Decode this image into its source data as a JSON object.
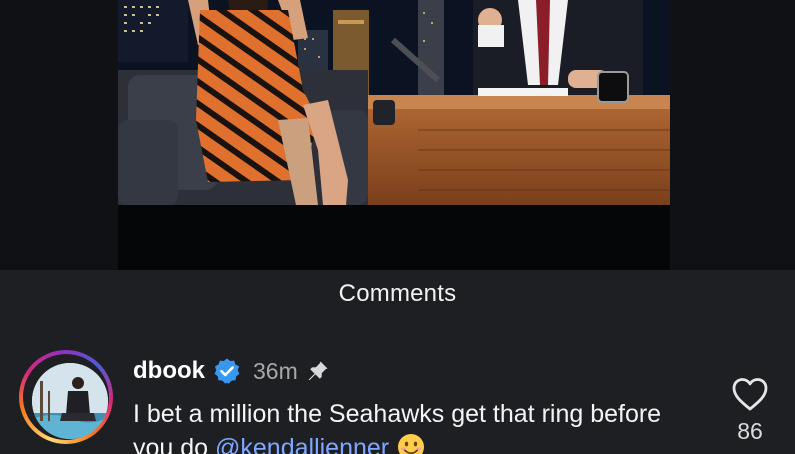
{
  "sheet": {
    "title": "Comments"
  },
  "comment": {
    "username": "dbook",
    "verified": true,
    "timestamp": "36m",
    "pinned": true,
    "text_before_mention": "I bet a million the Seahawks get that ring before you do ",
    "mention": "@kendalljenner",
    "emoji": "smiling-face-emoji",
    "like_count": "86"
  },
  "icons": {
    "verified": "verified-badge-icon",
    "pin": "pin-icon",
    "like": "heart-outline-icon"
  },
  "colors": {
    "background": "#1e1f23",
    "mention": "#7fa7ff",
    "verified_badge": "#3897f0"
  }
}
